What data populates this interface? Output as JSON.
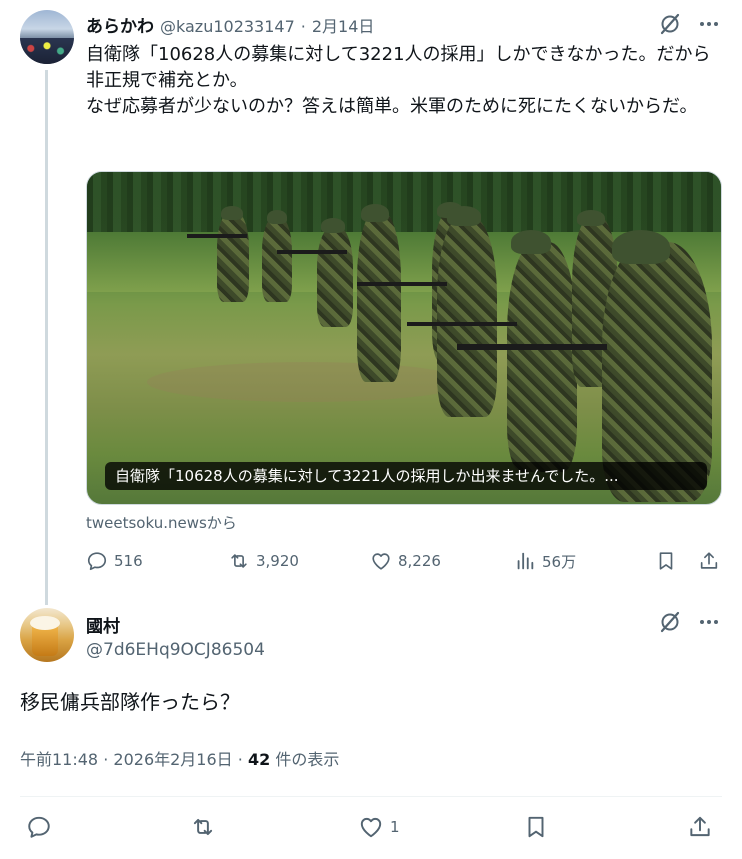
{
  "tweet": {
    "author_name": "あらかわ",
    "author_handle": "@kazu10233147",
    "separator": "·",
    "date": "2月14日",
    "text": "自衛隊「10628人の募集に対して3221人の採用」しかできなかった。だから非正規で補充とか。\nなぜ応募者が少ないのか？答えは簡単。米軍のために死にたくないからだ。",
    "card_caption": "自衛隊「10628人の募集に対して3221人の採用しか出来ませんでした。...",
    "card_source": "tweetsoku.newsから",
    "stats": {
      "replies": "516",
      "retweets": "3,920",
      "likes": "8,226",
      "views": "56万"
    }
  },
  "reply": {
    "author_name": "國村",
    "author_handle": "@7d6EHq9OCJ86504",
    "text": "移民傭兵部隊作ったら？",
    "time": "午前11:48",
    "sep1": "·",
    "date": "2026年2月16日",
    "sep2": "·",
    "view_count": "42",
    "view_label": "件の表示",
    "stats": {
      "likes": "1"
    }
  },
  "icons": {
    "grok": "grok-icon",
    "more": "more-icon",
    "reply": "reply-icon",
    "retweet": "retweet-icon",
    "like": "heart-icon",
    "views": "views-icon",
    "bookmark": "bookmark-icon",
    "share": "share-icon"
  },
  "colors": {
    "text": "#0f1419",
    "secondary": "#536471",
    "thread_line": "#cfd9de"
  }
}
